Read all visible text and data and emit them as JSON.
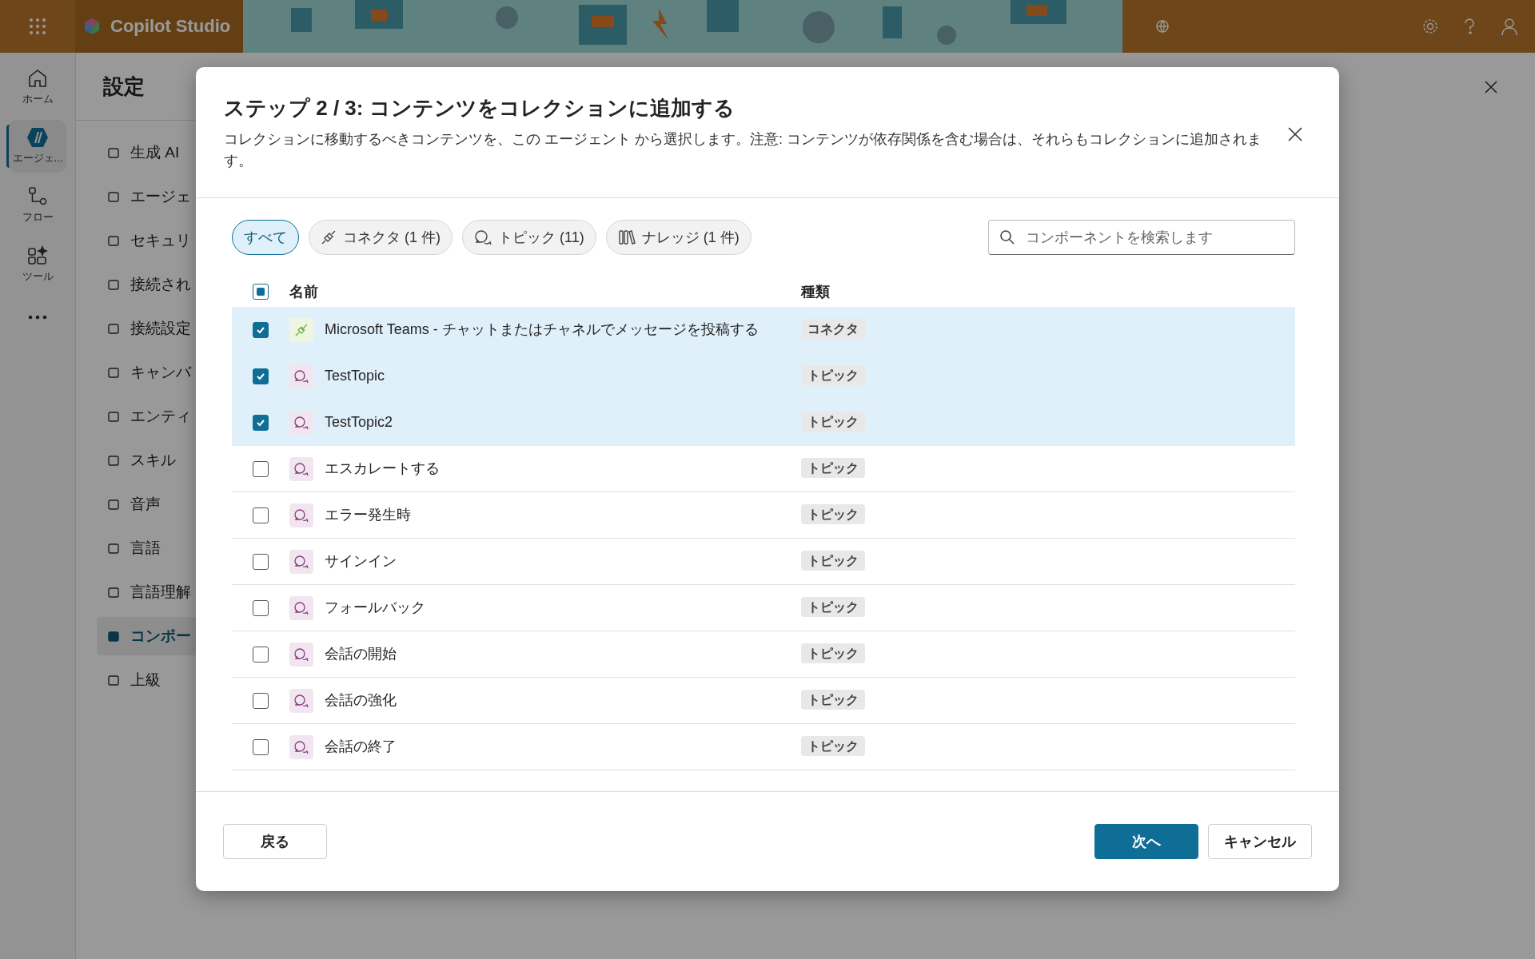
{
  "top_bar": {
    "app_title": "Copilot Studio"
  },
  "rail": [
    {
      "label": "ホーム",
      "selected": false
    },
    {
      "label": "エージェ...",
      "selected": true
    },
    {
      "label": "フロー",
      "selected": false
    },
    {
      "label": "ツール",
      "selected": false
    }
  ],
  "settings": {
    "title": "設定",
    "items": [
      {
        "label": "生成 AI",
        "selected": false
      },
      {
        "label": "エージェ",
        "selected": false
      },
      {
        "label": "セキュリ",
        "selected": false
      },
      {
        "label": "接続され",
        "selected": false
      },
      {
        "label": "接続設定",
        "selected": false
      },
      {
        "label": "キャンバ",
        "selected": false
      },
      {
        "label": "エンティ",
        "selected": false
      },
      {
        "label": "スキル",
        "selected": false
      },
      {
        "label": "音声",
        "selected": false
      },
      {
        "label": "言語",
        "selected": false
      },
      {
        "label": "言語理解",
        "selected": false
      },
      {
        "label": "コンポー",
        "selected": true
      },
      {
        "label": "上級",
        "selected": false
      }
    ]
  },
  "dialog": {
    "title": "ステップ 2 / 3: コンテンツをコレクションに追加する",
    "description": "コレクションに移動するべきコンテンツを、この エージェント から選択します。注意: コンテンツが依存関係を含む場合は、それらもコレクションに追加されます。",
    "filters": [
      {
        "label": "すべて",
        "kind": "all",
        "selected": true
      },
      {
        "label": "コネクタ (1 件)",
        "kind": "connector",
        "selected": false
      },
      {
        "label": "トピック (11)",
        "kind": "topic",
        "selected": false
      },
      {
        "label": "ナレッジ (1 件)",
        "kind": "knowledge",
        "selected": false
      }
    ],
    "search": {
      "placeholder": "コンポーネントを検索します"
    },
    "select_all": {
      "indeterminate": true
    },
    "columns": [
      "名前",
      "種類"
    ],
    "rows": [
      {
        "name": "Microsoft Teams - チャットまたはチャネルでメッセージを投稿する",
        "type": "コネクタ",
        "kind": "connector",
        "selected": true
      },
      {
        "name": "TestTopic",
        "type": "トピック",
        "kind": "topic",
        "selected": true
      },
      {
        "name": "TestTopic2",
        "type": "トピック",
        "kind": "topic",
        "selected": true
      },
      {
        "name": "エスカレートする",
        "type": "トピック",
        "kind": "topic",
        "selected": false
      },
      {
        "name": "エラー発生時",
        "type": "トピック",
        "kind": "topic",
        "selected": false
      },
      {
        "name": "サインイン",
        "type": "トピック",
        "kind": "topic",
        "selected": false
      },
      {
        "name": "フォールバック",
        "type": "トピック",
        "kind": "topic",
        "selected": false
      },
      {
        "name": "会話の開始",
        "type": "トピック",
        "kind": "topic",
        "selected": false
      },
      {
        "name": "会話の強化",
        "type": "トピック",
        "kind": "topic",
        "selected": false
      },
      {
        "name": "会話の終了",
        "type": "トピック",
        "kind": "topic",
        "selected": false
      }
    ],
    "buttons": {
      "back": "戻る",
      "next": "次へ",
      "cancel": "キャンセル"
    }
  }
}
